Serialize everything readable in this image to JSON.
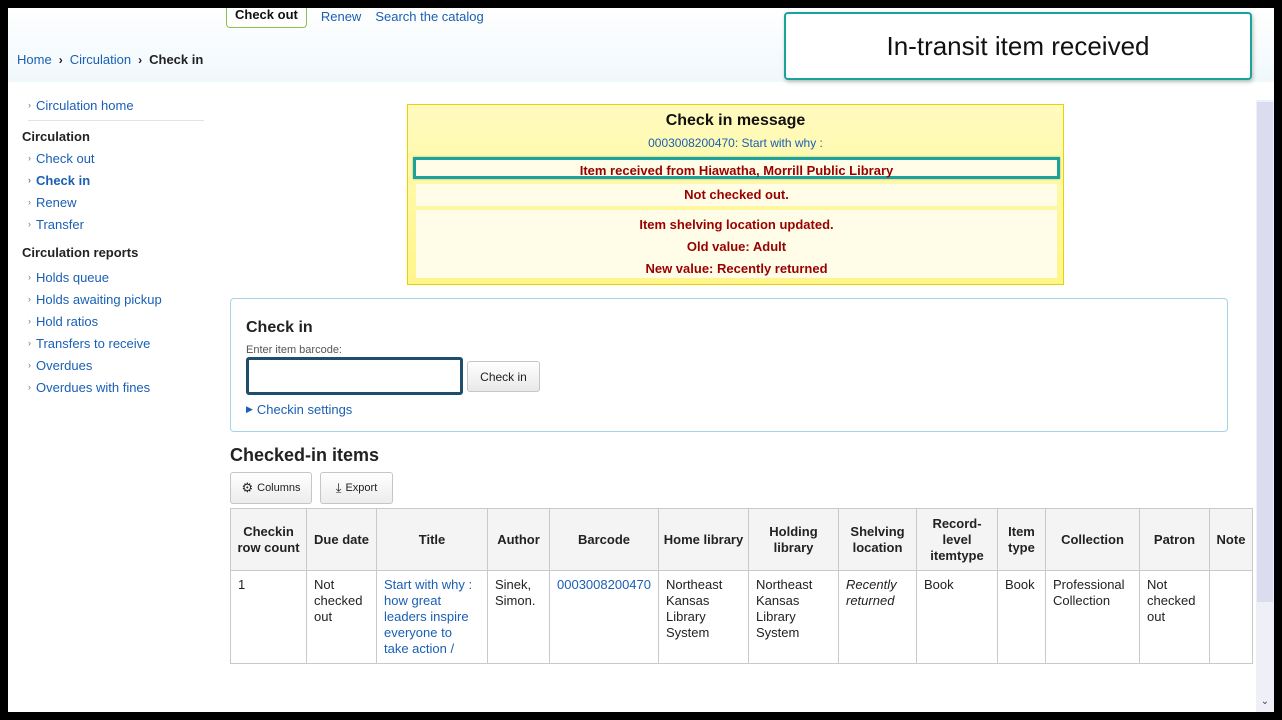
{
  "topbar": {
    "checkout_tab": "Check out",
    "renew_link": "Renew",
    "search_link": "Search the catalog"
  },
  "breadcrumb": {
    "home": "Home",
    "circulation": "Circulation",
    "current": "Check in"
  },
  "callout": {
    "text": "In-transit item received"
  },
  "sidebar": {
    "circ_home": "Circulation home",
    "circulation_heading": "Circulation",
    "circulation_items": [
      "Check out",
      "Check in",
      "Renew",
      "Transfer"
    ],
    "reports_heading": "Circulation reports",
    "report_items": [
      "Holds queue",
      "Holds awaiting pickup",
      "Hold ratios",
      "Transfers to receive",
      "Overdues",
      "Overdues with fines"
    ]
  },
  "message": {
    "title": "Check in message",
    "subtitle": "0003008200470: Start with why :",
    "received": "Item received from Hiawatha, Morrill Public Library",
    "not_checked_out": "Not checked out.",
    "shelving_updated": "Item shelving location updated.",
    "old_value": "Old value: Adult",
    "new_value": "New value: Recently returned"
  },
  "checkin_form": {
    "title": "Check in",
    "barcode_label": "Enter item barcode:",
    "barcode_value": "",
    "button": "Check in",
    "settings": "Checkin settings"
  },
  "checked_in": {
    "title": "Checked-in items",
    "columns_button": "Columns",
    "export_button": "Export",
    "headers": [
      "Checkin row count",
      "Due date",
      "Title",
      "Author",
      "Barcode",
      "Home library",
      "Holding library",
      "Shelving location",
      "Record-level itemtype",
      "Item type",
      "Collection",
      "Patron",
      "Note"
    ],
    "rows": [
      {
        "count": "1",
        "due": "Not checked out",
        "title": "Start with why : how great leaders inspire everyone to take action /",
        "author": "Sinek, Simon.",
        "barcode": "0003008200470",
        "home": "Northeast Kansas Library System",
        "holding": "Northeast Kansas Library System",
        "shelving": "Recently returned",
        "record_type": "Book",
        "item_type": "Book",
        "collection": "Professional Collection",
        "patron": "Not checked out",
        "note": ""
      }
    ]
  },
  "colors": {
    "link": "#1a5fb4",
    "highlight": "#1aa39a",
    "message_bg": "#fff58a",
    "alert_text": "#990000"
  }
}
